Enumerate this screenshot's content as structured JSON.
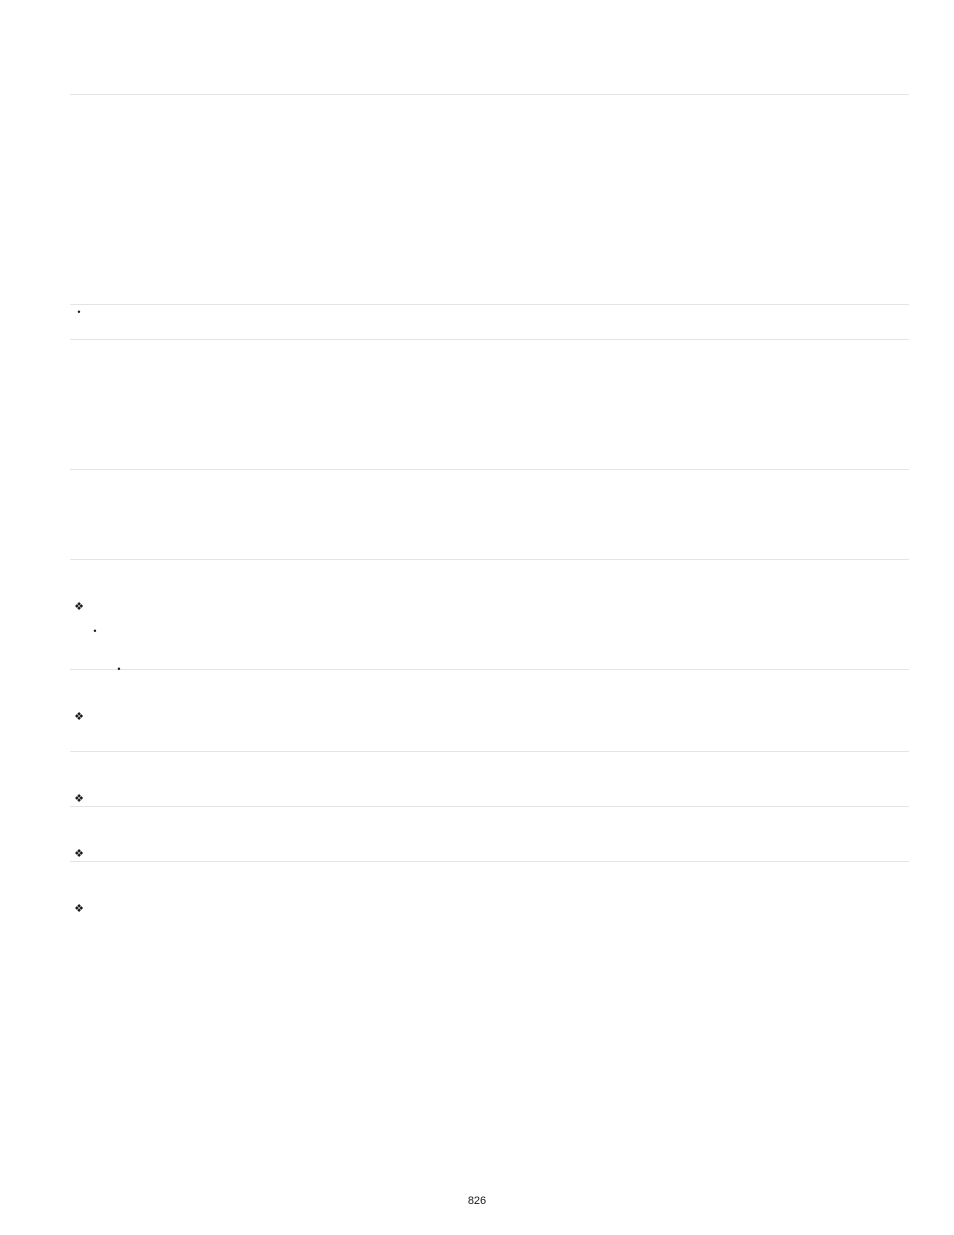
{
  "page_number": "826",
  "bullets": {
    "dot": "•",
    "flower": "❖"
  }
}
